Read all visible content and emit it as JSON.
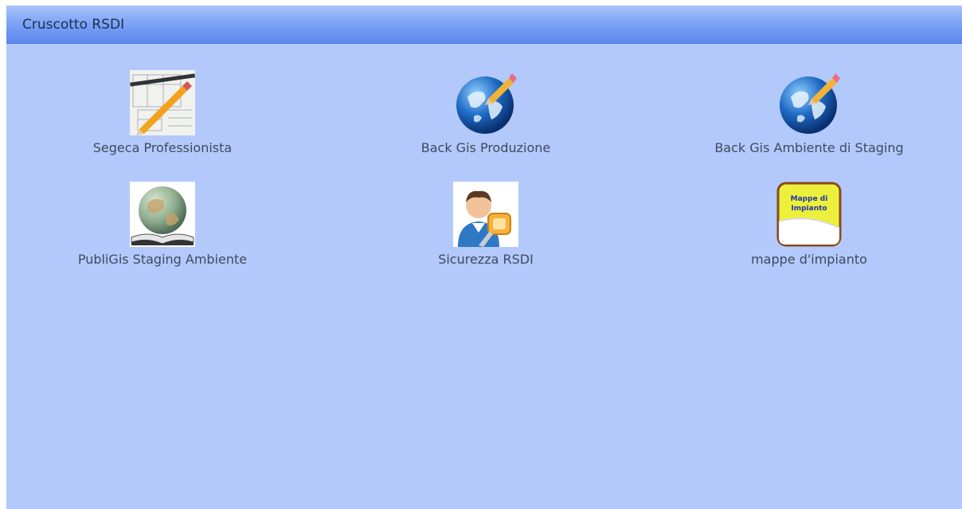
{
  "header": {
    "title": "Cruscotto RSDI"
  },
  "tiles": [
    {
      "label": "Segeca Professionista",
      "icon": "blueprint-pencil-icon"
    },
    {
      "label": "Back Gis Produzione",
      "icon": "globe-pencil-icon"
    },
    {
      "label": "Back Gis Ambiente di Staging",
      "icon": "globe-pencil-icon"
    },
    {
      "label": "PubliGis Staging Ambiente",
      "icon": "globe-book-icon"
    },
    {
      "label": "Sicurezza RSDI",
      "icon": "user-key-icon"
    },
    {
      "label": "mappe d'impianto",
      "icon": "mappe-di-impianto-icon",
      "icon_text": "Mappe di Impianto"
    }
  ],
  "colors": {
    "panel_bg": "#b3c9fb",
    "header_bg": "#6e97f2",
    "label_text": "#3e4a5e"
  }
}
